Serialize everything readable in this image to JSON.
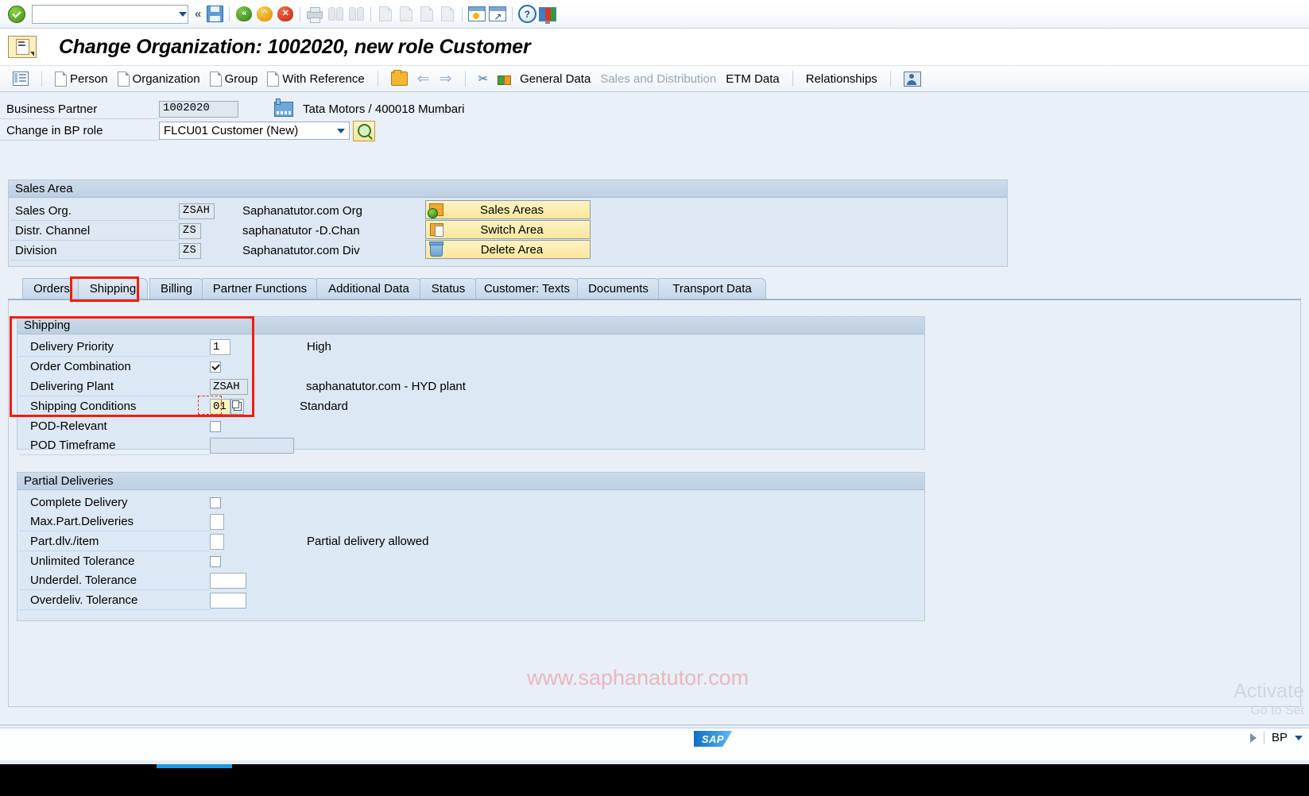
{
  "toolbar": {
    "command_value": "",
    "command_placeholder": "",
    "icons": [
      {
        "name": "enter-ok-icon",
        "title": "Enter"
      },
      {
        "name": "save-icon",
        "title": "Save"
      },
      {
        "name": "back-icon",
        "title": "Back"
      },
      {
        "name": "exit-icon",
        "title": "Exit"
      },
      {
        "name": "cancel-icon",
        "title": "Cancel"
      },
      {
        "name": "print-icon",
        "title": "Print"
      },
      {
        "name": "find-icon",
        "title": "Find"
      },
      {
        "name": "find-next-icon",
        "title": "Find Next"
      },
      {
        "name": "first-page-icon",
        "title": "First Page"
      },
      {
        "name": "previous-page-icon",
        "title": "Previous Page"
      },
      {
        "name": "next-page-icon",
        "title": "Next Page"
      },
      {
        "name": "last-page-icon",
        "title": "Last Page"
      },
      {
        "name": "create-session-icon",
        "title": "Create New Session"
      },
      {
        "name": "create-shortcut-icon",
        "title": "Create Shortcut"
      },
      {
        "name": "help-icon",
        "title": "Help"
      },
      {
        "name": "customize-layout-icon",
        "title": "Customize Local Layout"
      }
    ]
  },
  "title": {
    "text": "Change Organization: 1002020, new role Customer"
  },
  "appbar": {
    "items": [
      {
        "label": "Person",
        "icon": "document-icon"
      },
      {
        "label": "Organization",
        "icon": "document-icon"
      },
      {
        "label": "Group",
        "icon": "document-icon"
      },
      {
        "label": "With Reference",
        "icon": "document-icon"
      },
      {
        "label": "General Data",
        "icon": "",
        "dim": false
      },
      {
        "label": "Sales and Distribution",
        "icon": "",
        "dim": true
      },
      {
        "label": "ETM Data",
        "icon": "",
        "dim": false
      },
      {
        "label": "Relationships",
        "icon": "",
        "dim": false
      }
    ]
  },
  "header": {
    "business_partner_label": "Business Partner",
    "business_partner_value": "1002020",
    "partner_description": "Tata Motors / 400018 Mumbari",
    "bp_role_label": "Change in BP role",
    "bp_role_value": "FLCU01 Customer (New)"
  },
  "sales_area": {
    "group_title": "Sales Area",
    "rows": [
      {
        "label": "Sales Org.",
        "code": "ZSAH",
        "desc": "Saphanatutor.com Org"
      },
      {
        "label": "Distr. Channel",
        "code": "ZS",
        "desc": "saphanatutor -D.Chan"
      },
      {
        "label": "Division",
        "code": "ZS",
        "desc": "Saphanatutor.com Div"
      }
    ],
    "buttons": [
      {
        "label": "Sales Areas",
        "icon": "sales-areas-icon"
      },
      {
        "label": "Switch Area",
        "icon": "switch-area-icon"
      },
      {
        "label": "Delete Area",
        "icon": "delete-area-icon"
      }
    ]
  },
  "tabs": [
    {
      "label": "Orders",
      "active": false
    },
    {
      "label": "Shipping",
      "active": true
    },
    {
      "label": "Billing",
      "active": false
    },
    {
      "label": "Partner Functions",
      "active": false
    },
    {
      "label": "Additional Data",
      "active": false
    },
    {
      "label": "Status",
      "active": false
    },
    {
      "label": "Customer: Texts",
      "active": false
    },
    {
      "label": "Documents",
      "active": false
    },
    {
      "label": "Transport Data",
      "active": false
    }
  ],
  "shipping": {
    "group_title": "Shipping",
    "delivery_priority_label": "Delivery Priority",
    "delivery_priority_value": "1",
    "delivery_priority_desc": "High",
    "order_combination_label": "Order Combination",
    "order_combination_checked": true,
    "delivering_plant_label": "Delivering Plant",
    "delivering_plant_value": "ZSAH",
    "delivering_plant_desc": "saphanatutor.com - HYD plant",
    "shipping_conditions_label": "Shipping Conditions",
    "shipping_conditions_value": "01",
    "shipping_conditions_desc": "Standard",
    "pod_relevant_label": "POD-Relevant",
    "pod_relevant_checked": false,
    "pod_timeframe_label": "POD Timeframe",
    "pod_timeframe_value": ""
  },
  "partial_deliveries": {
    "group_title": "Partial Deliveries",
    "complete_delivery_label": "Complete Delivery",
    "complete_delivery_checked": false,
    "max_part_deliveries_label": "Max.Part.Deliveries",
    "max_part_deliveries_value": "",
    "part_dlv_item_label": "Part.dlv./item",
    "part_dlv_item_value": "",
    "part_dlv_item_desc": "Partial delivery allowed",
    "unlimited_tolerance_label": "Unlimited Tolerance",
    "unlimited_tolerance_checked": false,
    "underdel_tolerance_label": "Underdel. Tolerance",
    "underdel_tolerance_value": "",
    "overdeliv_tolerance_label": "Overdeliv. Tolerance",
    "overdeliv_tolerance_value": ""
  },
  "watermark": {
    "site": "www.saphanatutor.com",
    "activate_line1": "Activate",
    "activate_line2": "Go to Set"
  },
  "statusbar": {
    "logo": "SAP",
    "transaction": "BP"
  },
  "colors": {
    "accent": "#f21d0d",
    "panel": "#dce8f3",
    "button_yellow": "#fae79c"
  }
}
